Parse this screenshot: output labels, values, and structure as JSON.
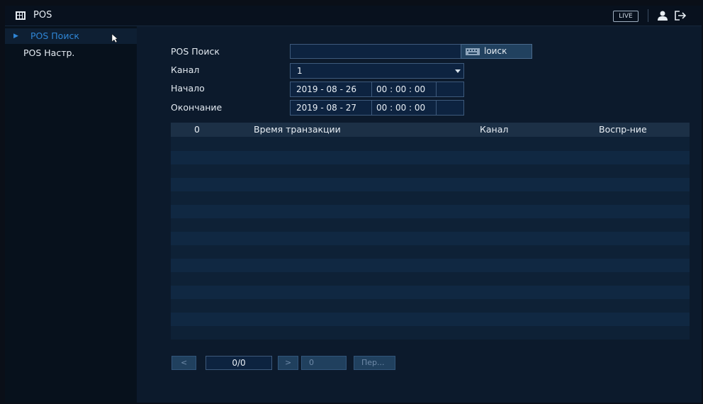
{
  "header": {
    "title": "POS",
    "live_label": "LIVE",
    "icons": [
      "pos-app-icon",
      "user-icon",
      "logout-icon"
    ]
  },
  "sidebar": {
    "items": [
      {
        "label": "POS Поиск",
        "active": true
      },
      {
        "label": "POS Настр.",
        "active": false
      }
    ]
  },
  "form": {
    "search_label": "POS Поиск",
    "search_value": "",
    "search_button": "loиск",
    "channel_label": "Канал",
    "channel_value": "1",
    "start_label": "Начало",
    "start_date": "2019 - 08 - 26",
    "start_time": "00 : 00 : 00",
    "end_label": "Окончание",
    "end_date": "2019 - 08 - 27",
    "end_time": "00 : 00 : 00"
  },
  "table": {
    "columns": [
      "0",
      "Время транзакции",
      "Канал",
      "Воспр-ние"
    ],
    "rows": []
  },
  "pager": {
    "prev_label": "<",
    "page_value": "0/0",
    "next_label": ">",
    "goto_value": "0",
    "goto_button": "Пер..."
  },
  "colors": {
    "accent": "#2f86d6",
    "background": "#0c1a2c",
    "sidebar": "#07111c"
  }
}
